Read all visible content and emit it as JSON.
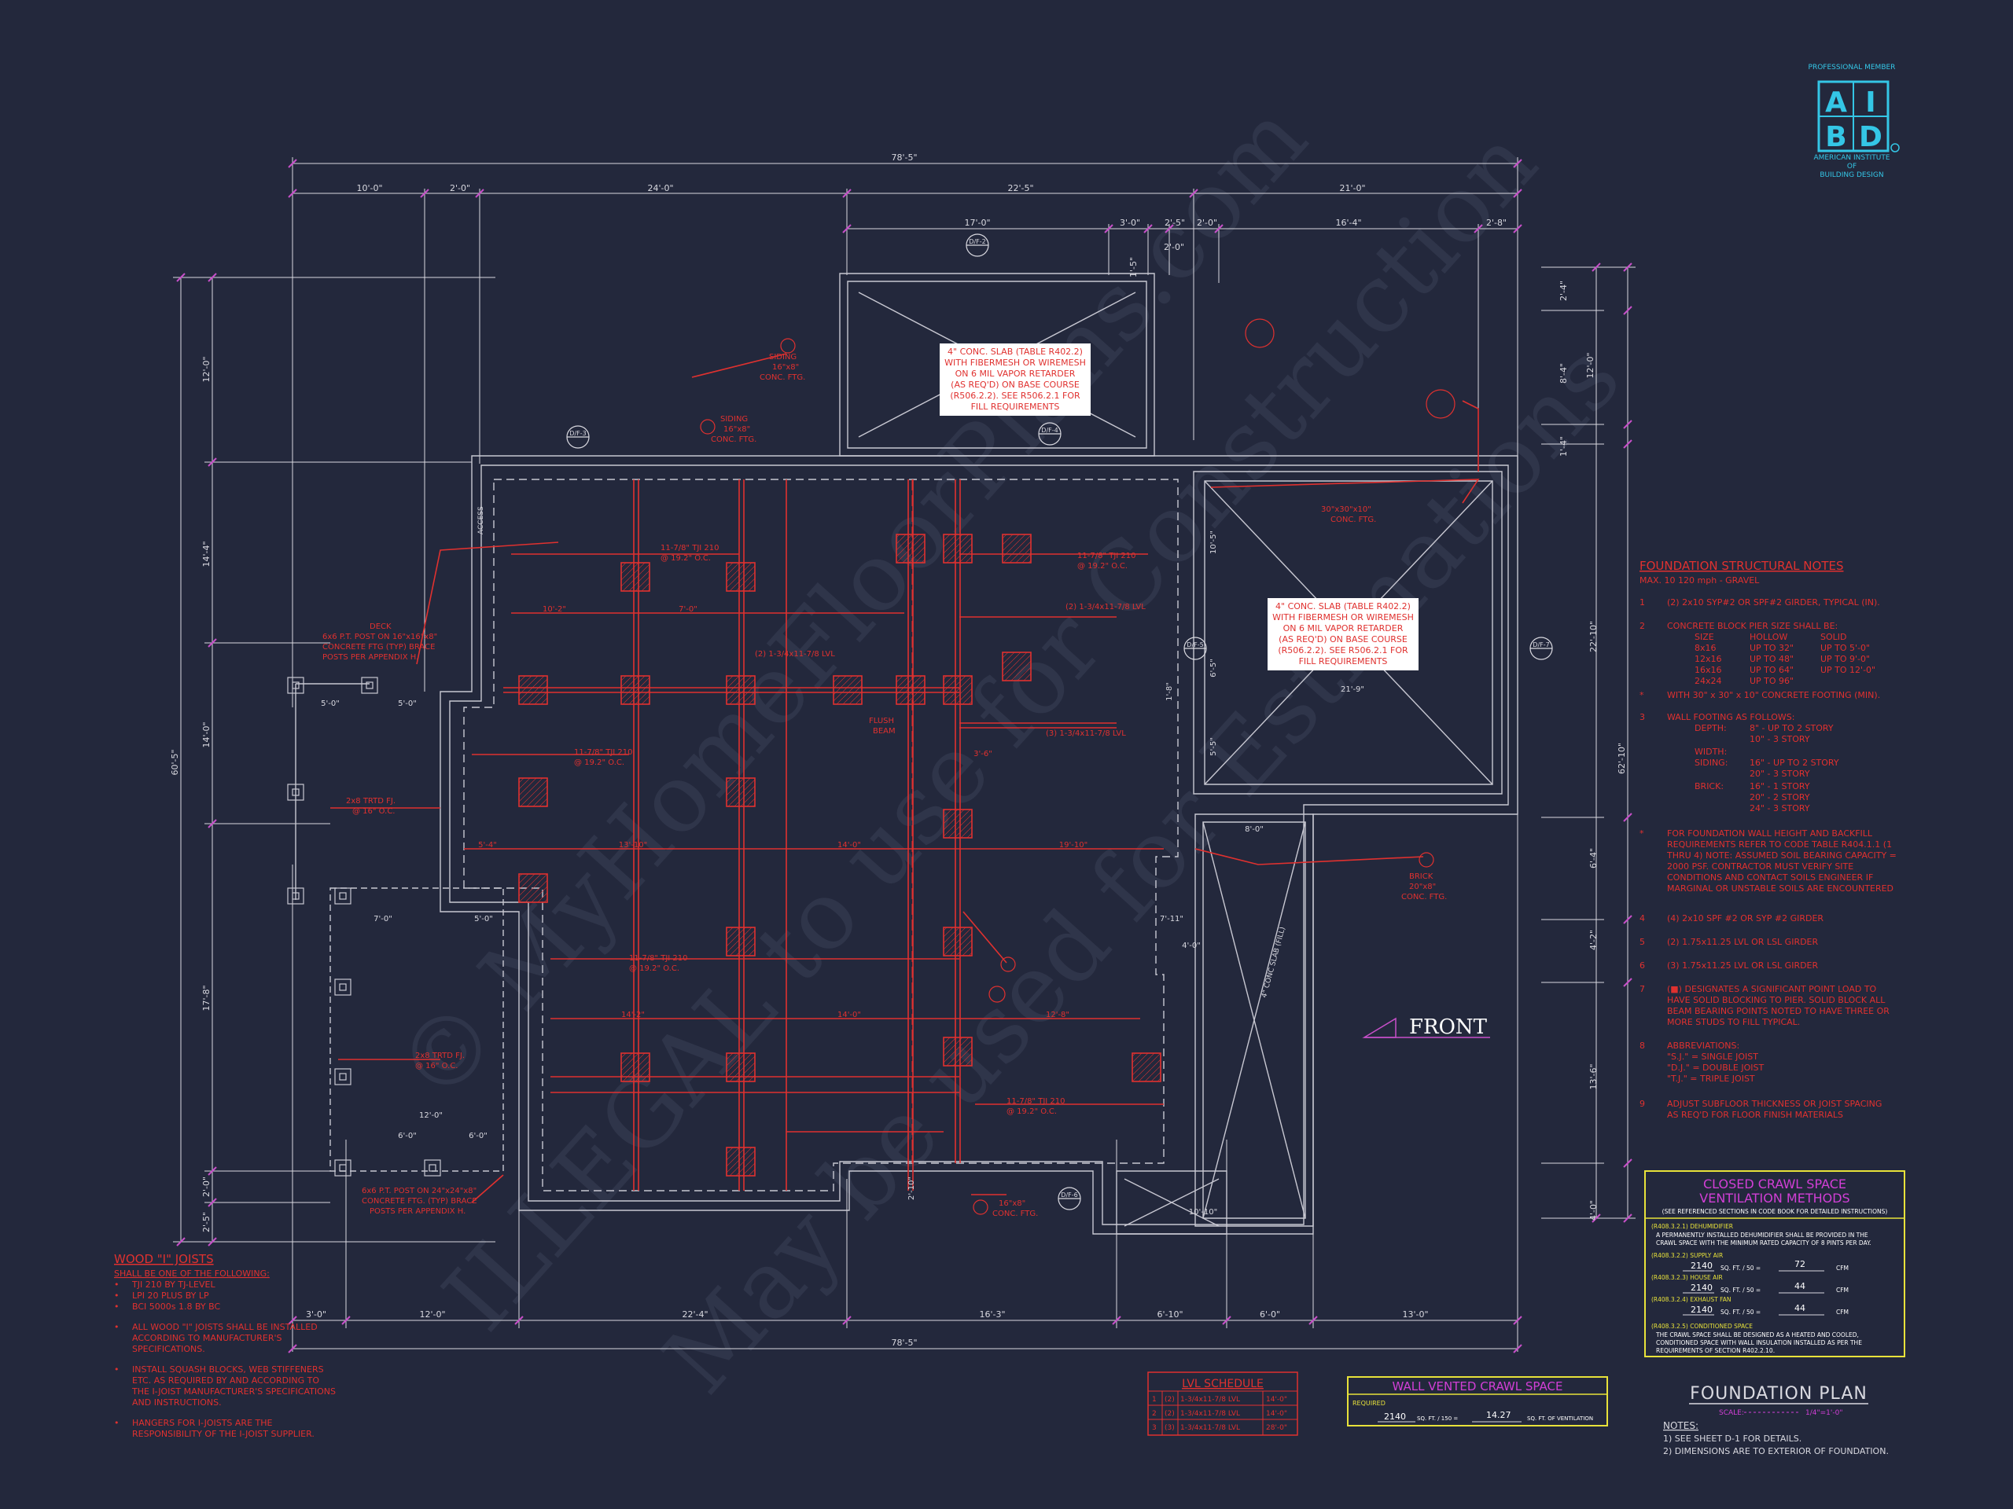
{
  "logo": {
    "top": "PROFESSIONAL MEMBER",
    "letters": [
      "A",
      "I",
      "B",
      "D"
    ],
    "bottom": [
      "AMERICAN INSTITUTE",
      "OF",
      "BUILDING DESIGN"
    ],
    "color": "#34c6e6"
  },
  "dims_top": {
    "overall": "78'-5\"",
    "row2": [
      "10'-0\"",
      "2'-0\"",
      "24'-0\"",
      "22'-5\"",
      "21'-0\""
    ],
    "row3": [
      "17'-0\"",
      "3'-0\"",
      "2'-5\"",
      "2'-0\"",
      "16'-4\"",
      "2'-8\""
    ],
    "small": [
      "2'-0\"",
      "1'-5\""
    ]
  },
  "dims_bottom": {
    "row": [
      "3'-0\"",
      "12'-0\"",
      "22'-4\"",
      "16'-3\"",
      "6'-10\"",
      "6'-0\"",
      "13'-0\""
    ],
    "overall": "78'-5\""
  },
  "dims_left": {
    "overall": "60'-5\"",
    "row": [
      "12'-0\"",
      "14'-4\"",
      "14'-0\"",
      "17'-8\"",
      "2'-0\"",
      "2'-5\""
    ]
  },
  "dims_right": {
    "overall": "62'-10\"",
    "row1": [
      "2'-4\"",
      "8'-4\"",
      "1'-4\"",
      "22'-10\"",
      "6'-4\"",
      "4'-2\"",
      "13'-6\"",
      "4'-0\""
    ],
    "row2": [
      "12'-0\"",
      "22'-10\"",
      "6'-4\""
    ]
  },
  "slab_note_1": [
    "4\" CONC. SLAB (TABLE R402.2)",
    "WITH FIBERMESH OR WIREMESH",
    "ON 6 MIL VAPOR RETARDER",
    "(AS REQ'D) ON BASE COURSE",
    "(R506.2.2). SEE R506.2.1 FOR",
    "FILL REQUIREMENTS"
  ],
  "slab_note_2": [
    "4\" CONC. SLAB (TABLE R402.2)",
    "WITH FIBERMESH OR WIREMESH",
    "ON 6 MIL VAPOR RETARDER",
    "(AS REQ'D) ON BASE COURSE",
    "(R506.2.2). SEE R506.2.1 FOR",
    "FILL REQUIREMENTS"
  ],
  "plan_labels": {
    "front": "FRONT",
    "access": "ACCESS",
    "deck": [
      "DECK",
      "6x6 P.T. POST ON 16\"x16\"x8\"",
      "CONCRETE FTG (TYP) BRACE",
      "POSTS PER APPENDIX H."
    ],
    "deck_bottom": [
      "6x6 P.T. POST ON 24\"x24\"x8\"",
      "CONCRETE FTG. (TYP) BRACE",
      "POSTS PER APPENDIX H."
    ],
    "siding_1": [
      "SIDING",
      "16\"x8\"",
      "CONC. FTG."
    ],
    "siding_2": [
      "SIDING",
      "16\"x8\"",
      "CONC. FTG."
    ],
    "brick": [
      "BRICK",
      "20\"x8\"",
      "CONC. FTG."
    ],
    "ftg_30": [
      "30\"x30\"x10\"",
      "CONC. FTG."
    ],
    "ftg_bottom": [
      "16\"x8\"",
      "CONC. FTG."
    ],
    "joist_1": [
      "11-7/8\" TJI 210",
      "@ 19.2\" O.C."
    ],
    "joist_2": [
      "11-7/8\" TJI 210",
      "@ 19.2\" O.C."
    ],
    "joist_3": [
      "11-7/8\" TJI 210",
      "@ 19.2\" O.C."
    ],
    "joist_4": [
      "11-7/8\" TJI 210",
      "@ 19.2\" O.C."
    ],
    "joist_5": [
      "11-7/8\" TJI 210",
      "@ 19.2\" O.C."
    ],
    "deck_joist_1": [
      "2x8 TRTD FJ.",
      "@ 16\" O.C."
    ],
    "deck_joist_2": [
      "2x8 TRTD FJ.",
      "@ 16\" O.C."
    ],
    "girder_1": "(2) 1-3/4x11-7/8 LVL",
    "girder_2": "(2) 1-3/4x11-7/8 LVL",
    "girder_3": "(3) 1-3/4x11-7/8 LVL",
    "flush": [
      "FLUSH",
      "BEAM"
    ],
    "inner_dims": [
      "10'-2\"",
      "7'-0\"",
      "5'-4\"",
      "13'-10\"",
      "14'-0\"",
      "19'-10\"",
      "14'-2\"",
      "14'-0\"",
      "12'-8\"",
      "3'-6\"",
      "21'-9\"",
      "8'-0\"",
      "4'-0\"",
      "10'-10\"",
      "5'-0\"",
      "5'-0\"",
      "7'-0\"",
      "5'-0\"",
      "6'-0\"",
      "6'-0\"",
      "12'-0\"",
      "2'-10\"",
      "7'-11\"",
      "1'-8\"",
      "10'-5\"",
      "5'-5\"",
      "6'-5\""
    ],
    "callouts": [
      "D/F-2",
      "D/F-3",
      "D/F-4",
      "D/F-5",
      "D/F-6",
      "D/F-7",
      "D/F-1"
    ],
    "ramp": "4\" CONC SLAB (FILL)",
    "numbers": [
      "1",
      "2",
      "3",
      "4",
      "5"
    ]
  },
  "structural_notes": {
    "title": "FOUNDATION STRUCTURAL NOTES",
    "subtitle": "MAX. 10 120 mph - GRAVEL",
    "items": [
      {
        "num": "1",
        "text": [
          "(2) 2x10 SYP#2 OR SPF#2 GIRDER, TYPICAL (IN)."
        ]
      },
      {
        "num": "2",
        "text": [
          "CONCRETE BLOCK PIER SIZE SHALL BE:"
        ],
        "table": [
          [
            "SIZE",
            "HOLLOW",
            "SOLID"
          ],
          [
            "8x16",
            "UP TO 32\"",
            "UP TO 5'-0\""
          ],
          [
            "12x16",
            "UP TO 48\"",
            "UP TO 9'-0\""
          ],
          [
            "16x16",
            "UP TO 64\"",
            "UP TO 12'-0\""
          ],
          [
            "24x24",
            "UP TO 96\"",
            ""
          ]
        ]
      },
      {
        "num": "*",
        "text": [
          "WITH 30\" x 30\" x 10\" CONCRETE FOOTING (MIN)."
        ]
      },
      {
        "num": "3",
        "text": [
          "WALL FOOTING AS FOLLOWS:"
        ],
        "table": [
          [
            "DEPTH:",
            "8\" - UP TO 2 STORY"
          ],
          [
            "",
            "10\" - 3 STORY"
          ],
          [
            "WIDTH:",
            ""
          ],
          [
            "SIDING:",
            "16\" - UP TO 2 STORY"
          ],
          [
            "",
            "20\" - 3 STORY"
          ],
          [
            "BRICK:",
            "16\" - 1 STORY"
          ],
          [
            "",
            "20\" - 2 STORY"
          ],
          [
            "",
            "24\" - 3 STORY"
          ]
        ]
      },
      {
        "num": "*",
        "text": [
          "FOR FOUNDATION WALL HEIGHT AND BACKFILL",
          "REQUIREMENTS REFER TO CODE TABLE R404.1.1 (1",
          "THRU 4) NOTE: ASSUMED SOIL BEARING CAPACITY =",
          "2000 PSF. CONTRACTOR MUST VERIFY SITE",
          "CONDITIONS AND CONTACT SOILS ENGINEER IF",
          "MARGINAL OR UNSTABLE SOILS ARE ENCOUNTERED"
        ]
      },
      {
        "num": "4",
        "text": [
          "(4) 2x10 SPF #2 OR SYP #2 GIRDER"
        ]
      },
      {
        "num": "5",
        "text": [
          "(2) 1.75x11.25 LVL OR LSL GIRDER"
        ]
      },
      {
        "num": "6",
        "text": [
          "(3) 1.75x11.25 LVL OR LSL GIRDER"
        ]
      },
      {
        "num": "7",
        "text": [
          "(■) DESIGNATES A SIGNIFICANT POINT LOAD TO",
          "HAVE SOLID BLOCKING TO PIER. SOLID BLOCK ALL",
          "BEAM BEARING POINTS NOTED TO HAVE THREE OR",
          "MORE STUDS TO FILL TYPICAL."
        ]
      },
      {
        "num": "8",
        "text": [
          "ABBREVIATIONS:",
          "\"S.J.\" = SINGLE JOIST",
          "\"D.J.\" = DOUBLE JOIST",
          "\"T.J.\" = TRIPLE JOIST"
        ]
      },
      {
        "num": "9",
        "text": [
          "ADJUST SUBFLOOR THICKNESS OR JOIST SPACING",
          "AS REQ'D FOR FLOOR FINISH MATERIALS"
        ]
      }
    ]
  },
  "wood_joists": {
    "title": "WOOD \"I\" JOISTS",
    "subtitle": "SHALL BE ONE OF THE FOLLOWING:",
    "items": [
      "TJI 210 BY TJ-LEVEL",
      "LPI 20 PLUS BY LP",
      "BCI 5000s 1.8 BY BC"
    ],
    "notes": [
      [
        "ALL WOOD \"I\" JOISTS SHALL BE INSTALLED",
        "ACCORDING TO MANUFACTURER'S",
        "SPECIFICATIONS."
      ],
      [
        "INSTALL SQUASH BLOCKS, WEB STIFFENERS",
        "ETC. AS REQUIRED BY AND ACCORDING TO",
        "THE I-JOIST MANUFACTURER'S SPECIFICATIONS",
        "AND INSTRUCTIONS."
      ],
      [
        "HANGERS FOR I-JOISTS ARE THE",
        "RESPONSIBILITY OF THE I-JOIST SUPPLIER."
      ]
    ]
  },
  "lvl_schedule": {
    "title": "LVL SCHEDULE",
    "rows": [
      [
        "1",
        "(2)",
        "1-3/4x11-7/8 LVL",
        "14'-0\""
      ],
      [
        "2",
        "(2)",
        "1-3/4x11-7/8 LVL",
        "14'-0\""
      ],
      [
        "3",
        "(3)",
        "1-3/4x11-7/8 LVL",
        "28'-0\""
      ]
    ]
  },
  "wall_vented": {
    "title": "WALL VENTED CRAWL SPACE",
    "required": "REQUIRED",
    "value1": "2140",
    "unit1": "SQ. FT. / 150 =",
    "value2": "14.27",
    "unit2": "SQ. FT. OF VENTILATION"
  },
  "closed_crawl": {
    "title": [
      "CLOSED CRAWL SPACE",
      "VENTILATION METHODS"
    ],
    "subtitle": "(SEE REFERENCED SECTIONS IN CODE BOOK FOR DETAILED INSTRUCTIONS)",
    "m1_head": "(R408.3.2.1) DEHUMIDIFIER",
    "m1_text": [
      "A PERMANENTLY INSTALLED DEHUMIDIFIER SHALL BE PROVIDED IN THE",
      "CRAWL SPACE WITH THE MINIMUM RATED CAPACITY OF 8 PINTS PER DAY."
    ],
    "m2_head": "(R408.3.2.2) SUPPLY AIR",
    "m2_val": "2140",
    "m2_unit": "SQ. FT. / 50 =",
    "m2_res": "72",
    "m2_res_unit": "CFM",
    "m3_head": "(R408.3.2.3) HOUSE AIR",
    "m3_val": "2140",
    "m3_unit": "SQ. FT. / 50 =",
    "m3_res": "44",
    "m3_res_unit": "CFM",
    "m4_head": "(R408.3.2.4) EXHAUST FAN",
    "m4_val": "2140",
    "m4_unit": "SQ. FT. / 50 =",
    "m4_res": "44",
    "m4_res_unit": "CFM",
    "m5_head": "(R408.3.2.5) CONDITIONED SPACE",
    "m5_text": [
      "THE CRAWL SPACE SHALL BE DESIGNED AS A HEATED AND COOLED,",
      "CONDITIONED SPACE WITH WALL INSULATION INSTALLED AS PER THE",
      "REQUIREMENTS OF SECTION R402.2.10."
    ]
  },
  "title_block": {
    "title": "FOUNDATION PLAN",
    "scale_label": "SCALE:",
    "scale": "1/4\"=1'-0\"",
    "notes_label": "NOTES:",
    "notes": [
      "1) SEE SHEET D-1 FOR DETAILS.",
      "2) DIMENSIONS ARE TO EXTERIOR OF FOUNDATION."
    ]
  },
  "watermark": [
    "© MyHomeFloorPlans.com",
    "ILLEGAL to use for Construction",
    "May be used for Estimations"
  ],
  "colors": {
    "background": "#23283c",
    "dimension": "#d9d9e0",
    "dim_tick": "#c74fc9",
    "wall": "#c8c8d2",
    "red": "#e0312f",
    "magenta": "#d23fd6",
    "yellow": "#e8e23a",
    "cyan": "#34c6e6"
  }
}
